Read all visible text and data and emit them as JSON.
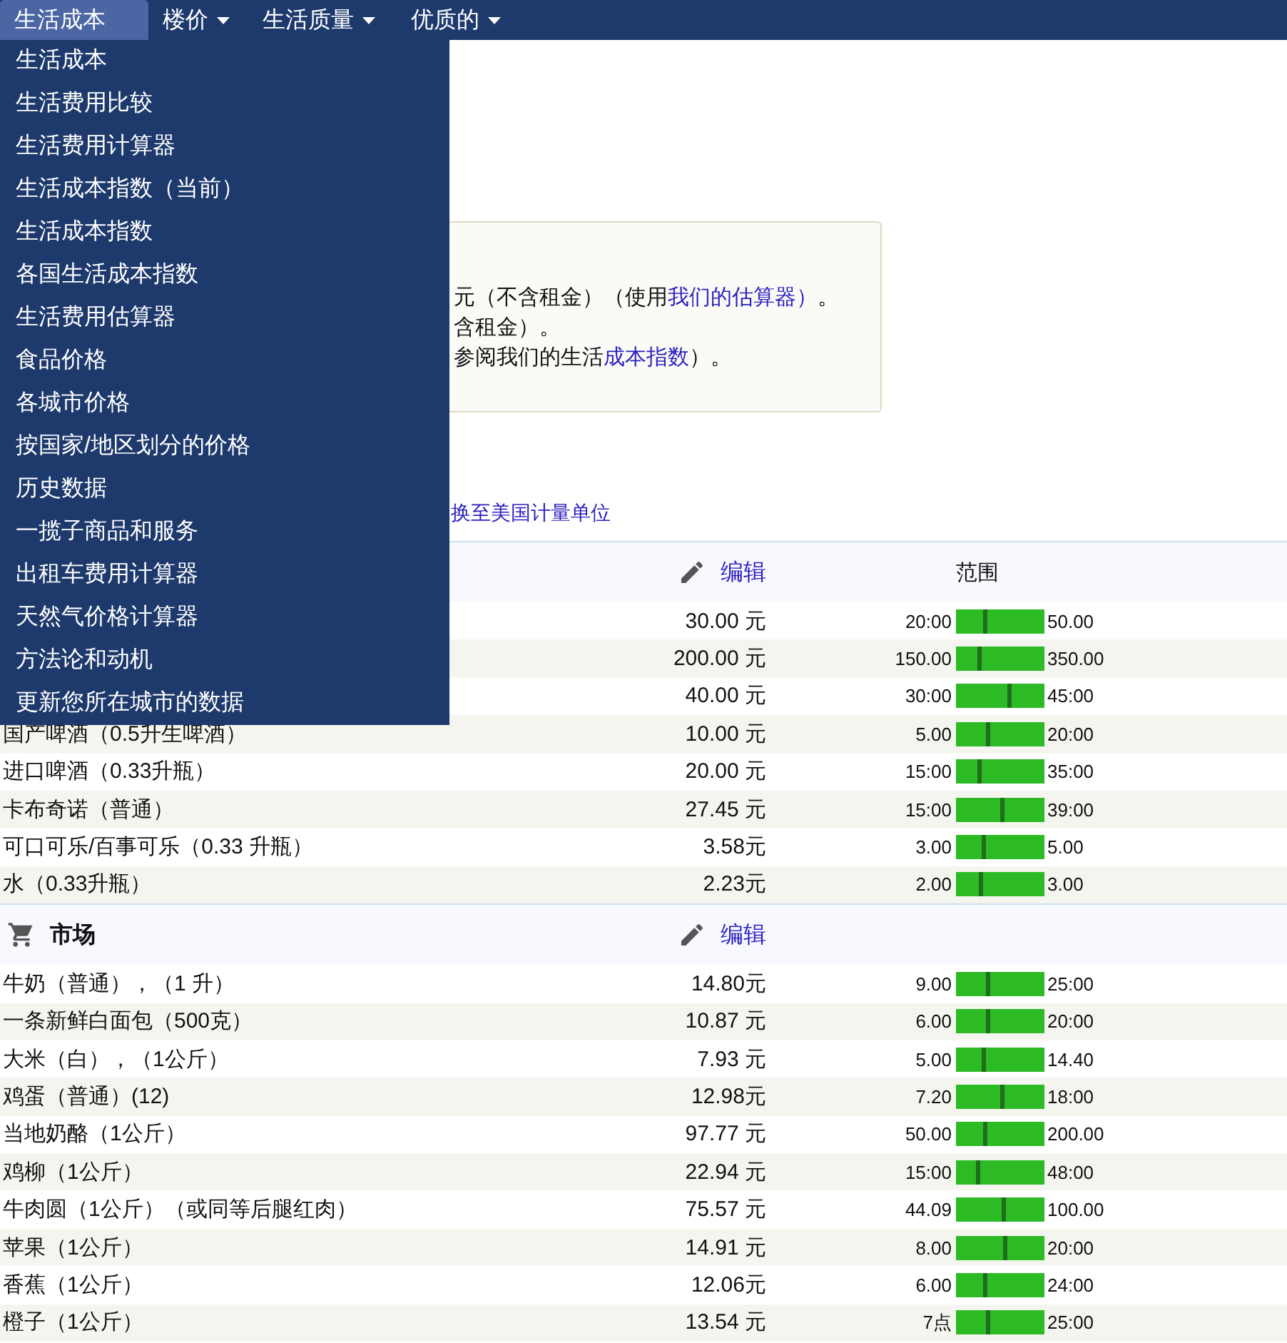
{
  "nav": [
    {
      "label": "生活成本",
      "selected": true,
      "caret": false
    },
    {
      "label": "楼价",
      "selected": false,
      "caret": true
    },
    {
      "label": "生活质量",
      "selected": false,
      "caret": true
    },
    {
      "label": "优质的",
      "selected": false,
      "caret": true
    }
  ],
  "dropdown": [
    "生活成本",
    "生活费用比较",
    "生活费用计算器",
    "生活成本指数（当前）",
    "生活成本指数",
    "各国生活成本指数",
    "生活费用估算器",
    "食品价格",
    "各城市价格",
    "按国家/地区划分的价格",
    "历史数据",
    "一揽子商品和服务",
    "出租车费用计算器",
    "天然气价格计算器",
    "方法论和动机",
    "更新您所在城市的数据"
  ],
  "info": [
    {
      "text": "元（不含租金）（使用",
      "link": "我们的估算器）",
      "after": "。"
    },
    {
      "text": "含租金）。"
    },
    {
      "text": "参阅我们的生活",
      "link": "成本指数",
      "after": "）。"
    }
  ],
  "units_link": "换至美国计量单位",
  "sections": [
    {
      "edit": "编辑",
      "range_heading": "范围",
      "rows": [
        {
          "price": "30.00 元",
          "range": {
            "min": "20:00",
            "max": "50.00",
            "level": 0.32
          }
        },
        {
          "price": "200.00 元",
          "range": {
            "min": "150.00",
            "max": "350.00",
            "level": 0.26
          }
        },
        {
          "price": "40.00 元",
          "range": {
            "min": "30:00",
            "max": "45:00",
            "level": 0.6
          }
        },
        {
          "name": "国产啤酒（0.5升生啤酒）",
          "price": "10.00 元",
          "range": {
            "min": "5.00",
            "max": "20:00",
            "level": 0.35
          }
        },
        {
          "name": "进口啤酒（0.33升瓶）",
          "price": "20.00 元",
          "range": {
            "min": "15:00",
            "max": "35:00",
            "level": 0.26
          }
        },
        {
          "name": "卡布奇诺（普通）",
          "price": "27.45 元",
          "range": {
            "min": "15:00",
            "max": "39:00",
            "level": 0.51
          }
        },
        {
          "name": "可口可乐/百事可乐（0.33 升瓶）",
          "price": "3.58元",
          "range": {
            "min": "3.00",
            "max": "5.00",
            "level": 0.31
          }
        },
        {
          "name": "水（0.33升瓶）",
          "price": "2.23元",
          "range": {
            "min": "2.00",
            "max": "3.00",
            "level": 0.28
          }
        }
      ]
    },
    {
      "title": "市场",
      "edit": "编辑",
      "rows": [
        {
          "name": "牛奶（普通），（1 升）",
          "price": "14.80元",
          "range": {
            "min": "9.00",
            "max": "25:00",
            "level": 0.35
          }
        },
        {
          "name": "一条新鲜白面包（500克）",
          "price": "10.87 元",
          "range": {
            "min": "6.00",
            "max": "20:00",
            "level": 0.35
          }
        },
        {
          "name": "大米（白），（1公斤）",
          "price": "7.93 元",
          "range": {
            "min": "5.00",
            "max": "14.40",
            "level": 0.31
          }
        },
        {
          "name": "鸡蛋（普通）(12)",
          "price": "12.98元",
          "range": {
            "min": "7.20",
            "max": "18:00",
            "level": 0.51
          }
        },
        {
          "name": "当地奶酪（1公斤）",
          "price": "97.77 元",
          "range": {
            "min": "50.00",
            "max": "200.00",
            "level": 0.32
          }
        },
        {
          "name": "鸡柳（1公斤）",
          "price": "22.94 元",
          "range": {
            "min": "15:00",
            "max": "48:00",
            "level": 0.24
          }
        },
        {
          "name": "牛肉圆（1公斤）（或同等后腿红肉）",
          "price": "75.57 元",
          "range": {
            "min": "44.09",
            "max": "100.00",
            "level": 0.53
          }
        },
        {
          "name": "苹果（1公斤）",
          "price": "14.91 元",
          "range": {
            "min": "8.00",
            "max": "20:00",
            "level": 0.55
          }
        },
        {
          "name": "香蕉（1公斤）",
          "price": "12.06元",
          "range": {
            "min": "6.00",
            "max": "24:00",
            "level": 0.33
          }
        },
        {
          "name": "橙子（1公斤）",
          "price": "13.54 元",
          "range": {
            "min": "7点",
            "max": "25:00",
            "level": 0.36
          }
        }
      ]
    }
  ]
}
